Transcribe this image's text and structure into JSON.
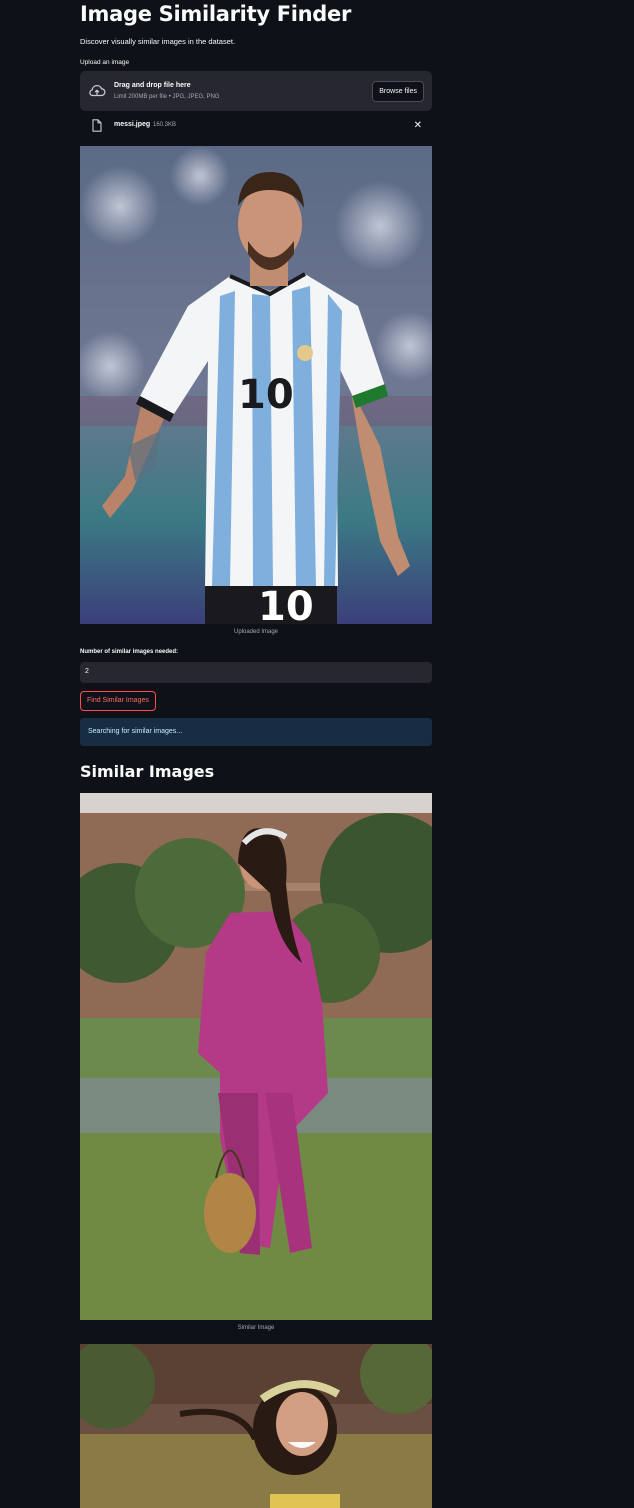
{
  "header": {
    "title": "Image Similarity Finder",
    "subtitle": "Discover visually similar images in the dataset."
  },
  "uploader": {
    "label": "Upload an image",
    "drop_text": "Drag and drop file here",
    "limit_text": "Limit 200MB per file • JPG, JPEG, PNG",
    "browse_label": "Browse files",
    "file_name": "messi.jpeg",
    "file_size": "160.3KB",
    "icons": {
      "upload": "cloud-upload-icon",
      "file": "file-icon",
      "remove": "close-icon"
    }
  },
  "uploaded_image": {
    "caption": "Uploaded Image",
    "shirt_text": "10"
  },
  "controls": {
    "count_label": "Number of similar images needed:",
    "count_value": "2",
    "find_label": "Find Similar Images"
  },
  "status": {
    "message": "Searching for similar images..."
  },
  "results": {
    "heading": "Similar Images",
    "items": [
      {
        "caption": "Similar Image"
      },
      {
        "caption": ""
      }
    ]
  },
  "colors": {
    "background": "#0e1117",
    "surface": "#262730",
    "accent": "#ff4b4b",
    "info_bg": "#172d43",
    "info_text": "#c7ebff"
  }
}
